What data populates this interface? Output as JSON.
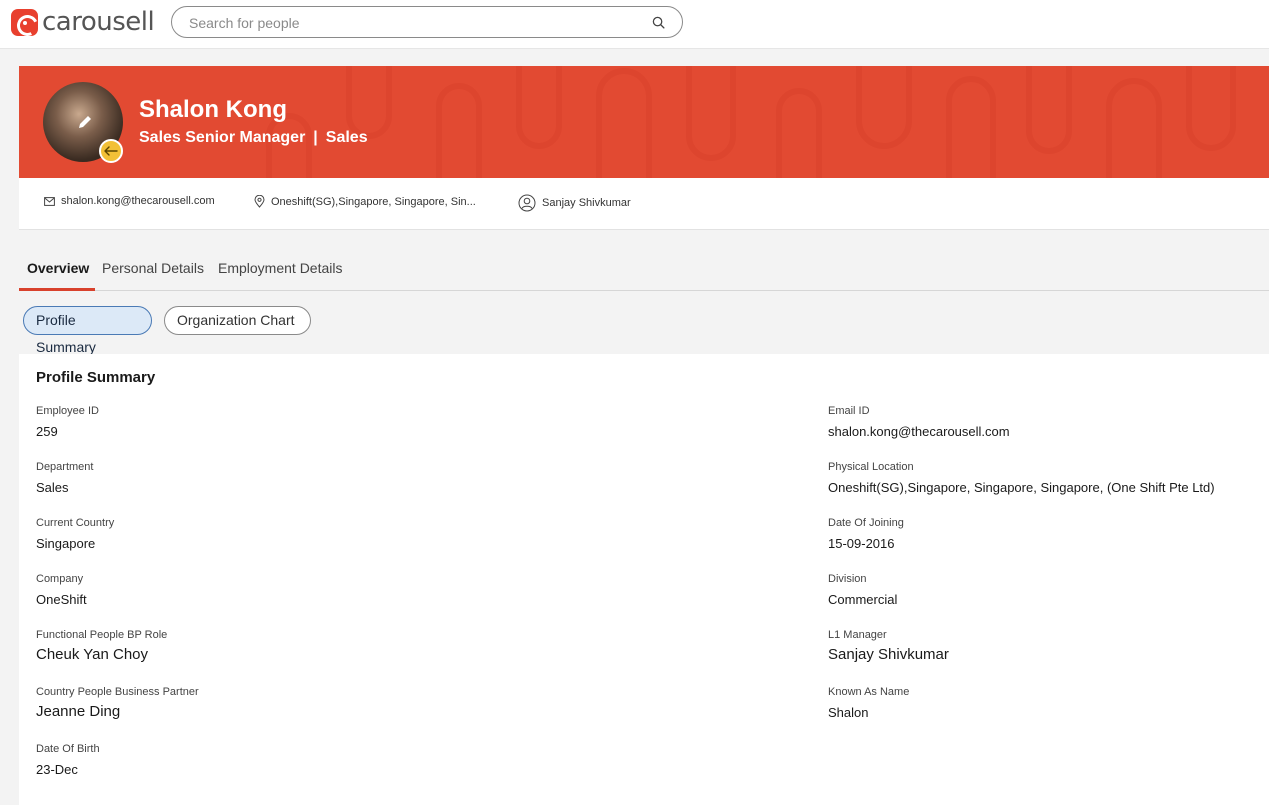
{
  "brand": {
    "name": "carousell",
    "color": "#e8402e"
  },
  "search": {
    "placeholder": "Search for people"
  },
  "profile": {
    "name": "Shalon Kong",
    "title": "Sales Senior Manager",
    "separator": "|",
    "department": "Sales",
    "email": "shalon.kong@thecarousell.com",
    "location": "Oneshift(SG),Singapore, Singapore, Sin...",
    "manager": "Sanjay Shivkumar",
    "hero_color": "#e24a32"
  },
  "tabs": [
    {
      "label": "Overview",
      "active": true
    },
    {
      "label": "Personal Details",
      "active": false
    },
    {
      "label": "Employment Details",
      "active": false
    }
  ],
  "subtabs": [
    {
      "label": "Profile Summary",
      "active": true
    },
    {
      "label": "Organization Chart",
      "active": false
    }
  ],
  "summary": {
    "title": "Profile Summary",
    "left": [
      {
        "label": "Employee ID",
        "value": "259"
      },
      {
        "label": "Department",
        "value": "Sales"
      },
      {
        "label": "Current Country",
        "value": "Singapore"
      },
      {
        "label": "Company",
        "value": "OneShift"
      },
      {
        "label": "Functional People BP Role",
        "value": "Cheuk Yan Choy"
      },
      {
        "label": "Country People Business Partner",
        "value": "Jeanne Ding"
      },
      {
        "label": "Date Of Birth",
        "value": "23-Dec"
      }
    ],
    "right": [
      {
        "label": "Email ID",
        "value": "shalon.kong@thecarousell.com"
      },
      {
        "label": "Physical Location",
        "value": "Oneshift(SG),Singapore, Singapore, Singapore, (One Shift Pte Ltd)"
      },
      {
        "label": "Date Of Joining",
        "value": "15-09-2016"
      },
      {
        "label": "Division",
        "value": "Commercial"
      },
      {
        "label": "L1 Manager",
        "value": "Sanjay Shivkumar"
      },
      {
        "label": "Known As Name",
        "value": "Shalon"
      }
    ]
  }
}
